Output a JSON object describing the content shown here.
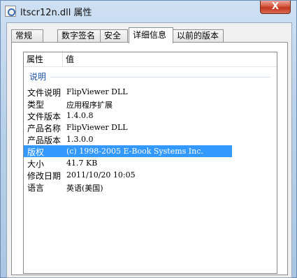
{
  "window": {
    "title": "ltscr12n.dll 属性",
    "close_label": "X"
  },
  "tabs": [
    {
      "label": "常规"
    },
    {
      "label": "数字签名"
    },
    {
      "label": "安全"
    },
    {
      "label": "详细信息"
    },
    {
      "label": "以前的版本"
    }
  ],
  "active_tab": "详细信息",
  "columns": {
    "property": "属性",
    "value": "值"
  },
  "group": {
    "label": "说明"
  },
  "rows": [
    {
      "name": "文件说明",
      "value": "FlipViewer DLL"
    },
    {
      "name": "类型",
      "value": "应用程序扩展"
    },
    {
      "name": "文件版本",
      "value": "1.4.0.8"
    },
    {
      "name": "产品名称",
      "value": "FlipViewer DLL"
    },
    {
      "name": "产品版本",
      "value": "1.3.0.0"
    },
    {
      "name": "版权",
      "value": "(c) 1998-2005 E-Book Systems Inc."
    },
    {
      "name": "大小",
      "value": "41.7 KB"
    },
    {
      "name": "修改日期",
      "value": "2011/10/20 10:05"
    },
    {
      "name": "语言",
      "value": "英语(美国)"
    }
  ],
  "selected_row": "版权",
  "colors": {
    "selection": "#3399ff",
    "group_label": "#1e50a2"
  }
}
